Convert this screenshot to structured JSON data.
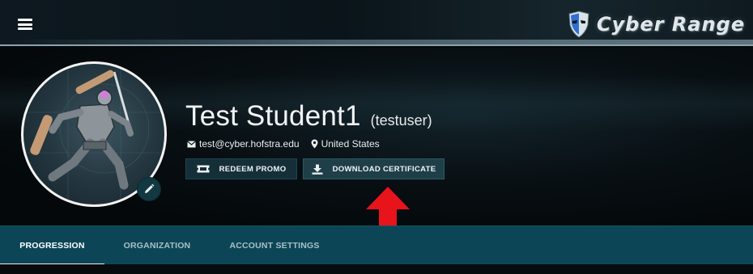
{
  "header": {
    "menu_icon": "hamburger-menu-icon",
    "logo_icon": "cyber-range-mask-icon",
    "logo_text": "Cyber Range"
  },
  "profile": {
    "name": "Test Student1",
    "username": "(testuser)",
    "email": "test@cyber.hofstra.edu",
    "location": "United States",
    "avatar_icon": "robot-ninja-avatar",
    "edit_icon": "pencil-icon"
  },
  "actions": {
    "redeem_label": "REDEEM PROMO",
    "redeem_icon": "ticket-icon",
    "download_label": "DOWNLOAD CERTIFICATE",
    "download_icon": "download-icon"
  },
  "annotation": {
    "icon": "red-up-arrow-icon",
    "color": "#e8141b"
  },
  "tabs": [
    {
      "label": "PROGRESSION",
      "active": true
    },
    {
      "label": "ORGANIZATION",
      "active": false
    },
    {
      "label": "ACCOUNT SETTINGS",
      "active": false
    }
  ],
  "colors": {
    "tab_bar": "#0c4656",
    "button_bg": "#142f38",
    "page_bg": "#05090c"
  }
}
